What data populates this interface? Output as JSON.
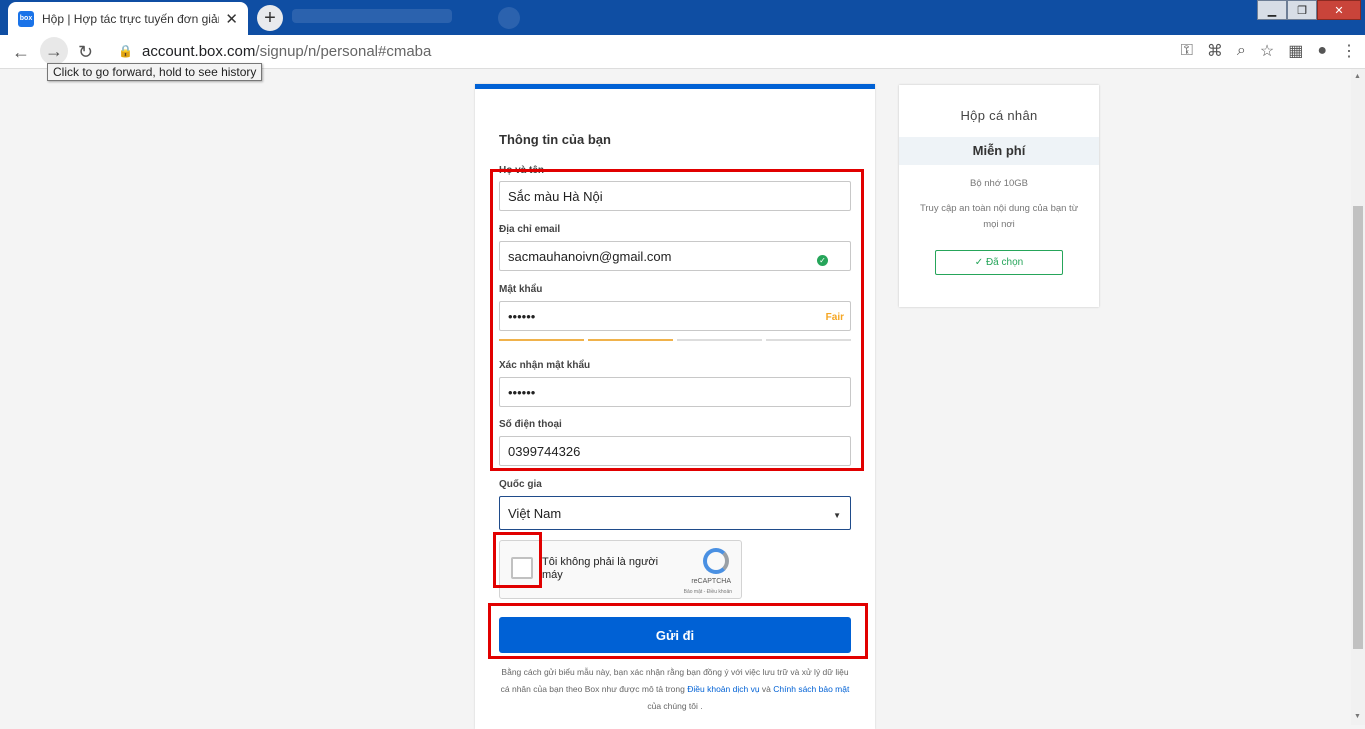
{
  "browser": {
    "tab_title": "Hộp | Hợp tác trực tuyến đơn giản",
    "favicon_text": "box",
    "url_host": "account.box.com",
    "url_path": "/signup/n/personal#cmaba",
    "tooltip": "Click to go forward, hold to see history"
  },
  "form": {
    "heading": "Thông tin của bạn",
    "fields": {
      "name": {
        "label": "Họ và tên",
        "value": "Sắc màu Hà Nội"
      },
      "email": {
        "label": "Địa chỉ email",
        "value": "sacmauhanoivn@gmail.com"
      },
      "password": {
        "label": "Mật khẩu",
        "value": "••••••",
        "strength": "Fair",
        "strength_level": 0.5
      },
      "confirm": {
        "label": "Xác nhận mật khẩu",
        "value": "••••••"
      },
      "phone": {
        "label": "Số điện thoại",
        "value": "0399744326"
      },
      "country": {
        "label": "Quốc gia",
        "value": "Việt Nam"
      }
    },
    "recaptcha": {
      "text": "Tôi không phải là người máy",
      "brand": "reCAPTCHA",
      "links": "Bảo mật - Điều khoản"
    },
    "submit_label": "Gửi đi",
    "disclaimer": {
      "part1": "Bằng cách gửi biểu mẫu này, bạn xác nhận rằng bạn đồng ý với việc lưu trữ và xử lý dữ liệu cá nhân của bạn theo Box như được mô tả trong",
      "terms_link": "Điều khoản dịch vụ",
      "and": "và",
      "privacy_link": "Chính sách bảo mật",
      "part2": "của chúng tôi ."
    }
  },
  "plan": {
    "title": "Hộp cá nhân",
    "price": "Miễn phí",
    "storage": "Bộ nhớ 10GB",
    "description": "Truy cập an toàn nội dung của bạn từ mọi nơi",
    "selected_label": "Đã chọn"
  },
  "colors": {
    "accent": "#0061d5",
    "annotation": "#e10000",
    "success": "#26a55a",
    "warning": "#f5a623"
  }
}
